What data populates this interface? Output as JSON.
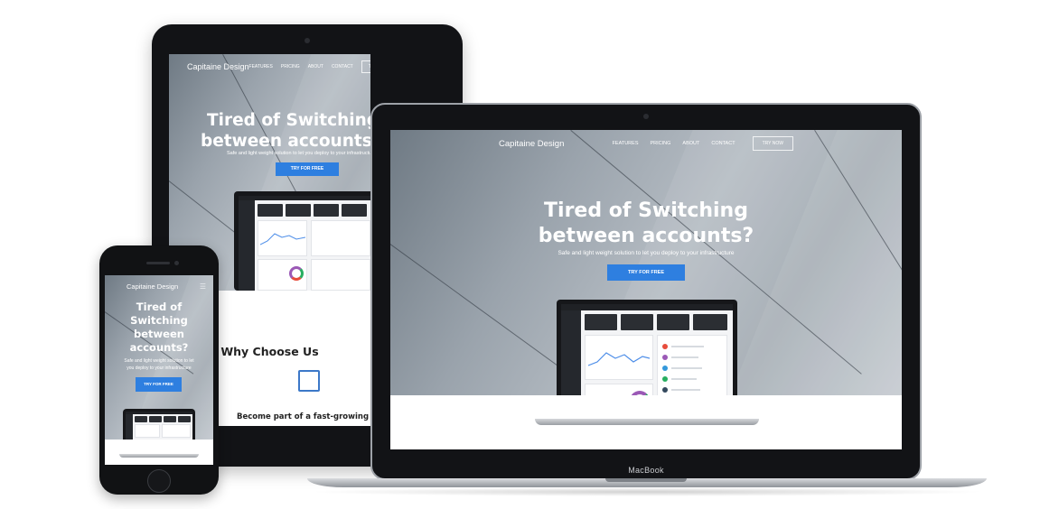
{
  "site": {
    "brand": "Capitaine Design",
    "nav": [
      "FEATURES",
      "PRICING",
      "ABOUT",
      "CONTACT"
    ],
    "try_now": "TRY NOW",
    "headline_line1": "Tired of Switching",
    "headline_line2": "between accounts?",
    "subtitle": "Safe and light weight solution to let you deploy to your infrastructure",
    "cta": "TRY FOR FREE",
    "why_title": "Why Choose Us",
    "why_subtitle": "Become part of a fast-growing area of th"
  },
  "phone": {
    "headline": [
      "Tired of",
      "Switching",
      "between",
      "accounts?"
    ],
    "subtitle": [
      "Safe and light weight solution to let",
      "you deploy to your infrastructure"
    ]
  },
  "device_label": "MacBook",
  "colors": {
    "accent": "#2e7fe0",
    "hero_gray": "#9aa3ac",
    "device_black": "#121316"
  }
}
